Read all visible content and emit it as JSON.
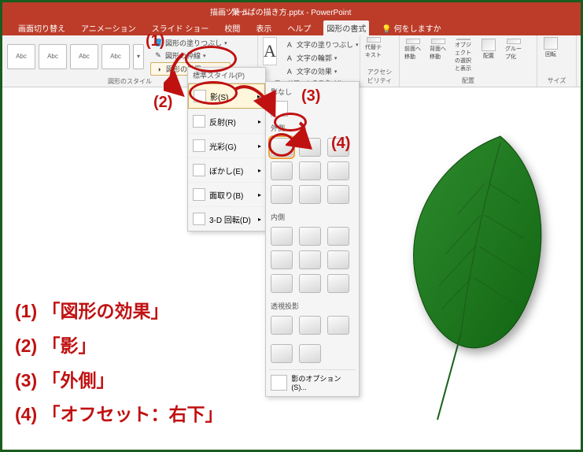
{
  "window": {
    "title": "葉っぱの描き方.pptx - PowerPoint",
    "drawtools": "描画ツール"
  },
  "tabs": {
    "transition": "画面切り替え",
    "animation": "アニメーション",
    "slideshow": "スライド ショー",
    "review": "校閲",
    "view": "表示",
    "help": "ヘルプ",
    "format": "図形の書式",
    "tellme": "何をしますか"
  },
  "ribbon": {
    "shape_styles_label": "図形のスタイル",
    "abc": "Abc",
    "fill_label": "図形の塗りつぶし",
    "outline_label": "図形の枠線",
    "effects_label": "図形の効果",
    "wordart_styles_label": "ワードアートのスタイル",
    "wa_a": "A",
    "text_fill": "文字の塗りつぶし",
    "text_outline": "文字の輪郭",
    "text_effects": "文字の効果",
    "alt_text": "代替テキスト",
    "accessibility": "アクセシビリティ",
    "bring_forward": "前面へ移動",
    "send_backward": "背面へ移動",
    "selection_pane": "オブジェクトの選択と表示",
    "align": "配置",
    "group": "グループ化",
    "rotate": "回転",
    "arrange_label": "配置",
    "size_label": "サイズ"
  },
  "effects_menu": {
    "header": "標準スタイル(P)",
    "shadow": "影(S)",
    "reflection": "反射(R)",
    "glow": "光彩(G)",
    "soft_edges": "ぼかし(E)",
    "bevel": "面取り(B)",
    "rotation3d": "3-D 回転(D)"
  },
  "shadow_gallery": {
    "none_label": "影なし",
    "outer_label": "外側",
    "inner_label": "内側",
    "perspective_label": "透視投影",
    "options": "影のオプション(S)..."
  },
  "annotations": {
    "n1": "(1)",
    "n2": "(2)",
    "n3": "(3)",
    "n4": "(4)"
  },
  "legend": {
    "l1": "(1) 「図形の効果」",
    "l2": "(2) 「影」",
    "l3": "(3) 「外側」",
    "l4": "(4) 「オフセット：右下」"
  }
}
